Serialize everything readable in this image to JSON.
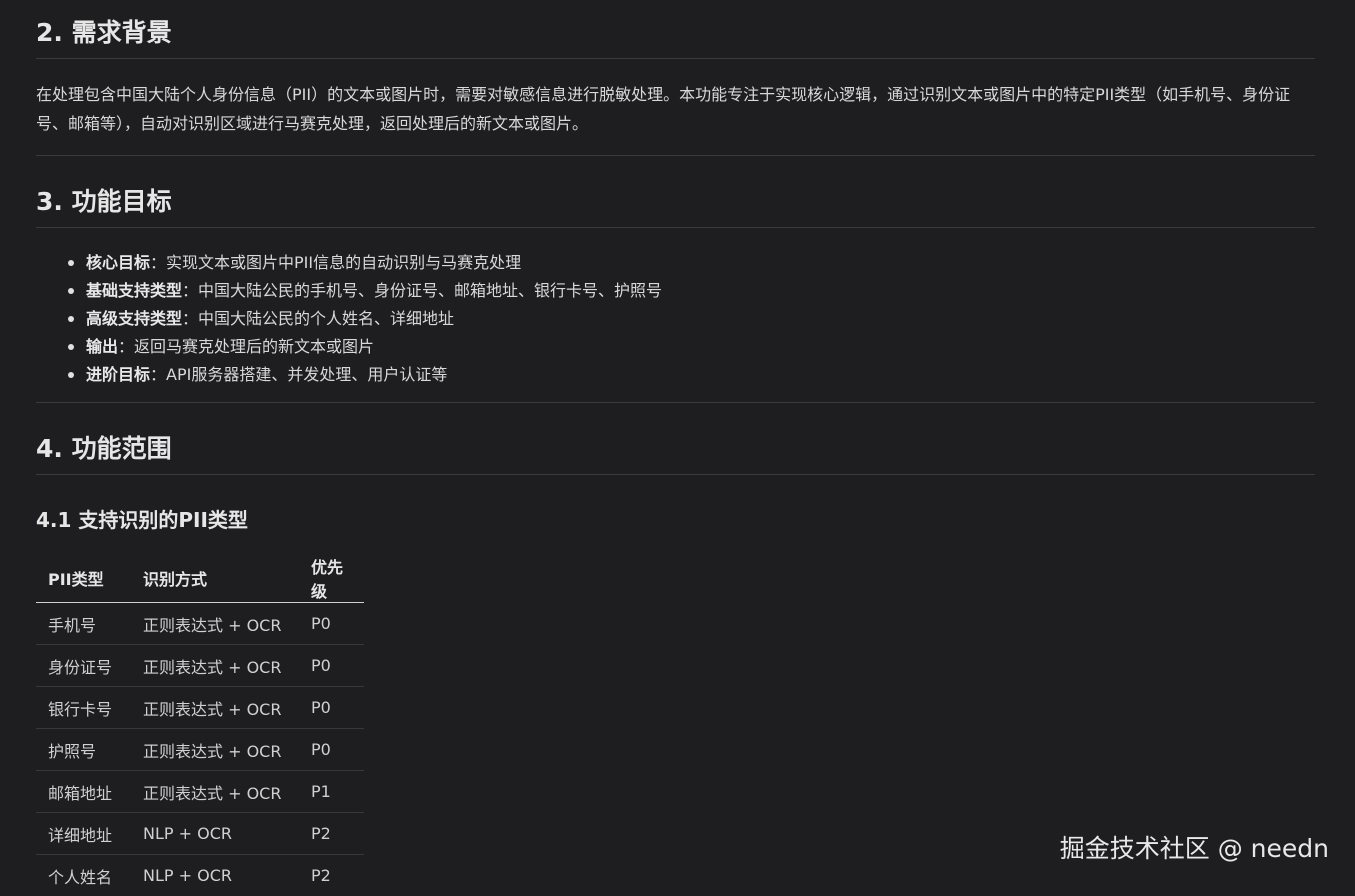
{
  "section2": {
    "title": "2. 需求背景",
    "paragraph": "在处理包含中国大陆个人身份信息（PII）的文本或图片时，需要对敏感信息进行脱敏处理。本功能专注于实现核心逻辑，通过识别文本或图片中的特定PII类型（如手机号、身份证号、邮箱等），自动对识别区域进行马赛克处理，返回处理后的新文本或图片。"
  },
  "section3": {
    "title": "3. 功能目标",
    "goals": [
      {
        "key": "核心目标",
        "sep": "：",
        "text": "实现文本或图片中PII信息的自动识别与马赛克处理"
      },
      {
        "key": "基础支持类型",
        "sep": "：",
        "text": "中国大陆公民的手机号、身份证号、邮箱地址、银行卡号、护照号"
      },
      {
        "key": "高级支持类型",
        "sep": "：",
        "text": "中国大陆公民的个人姓名、详细地址"
      },
      {
        "key": "输出",
        "sep": "：",
        "text": "返回马赛克处理后的新文本或图片"
      },
      {
        "key": "进阶目标",
        "sep": "：",
        "text": "API服务器搭建、并发处理、用户认证等"
      }
    ]
  },
  "section4": {
    "title": "4. 功能范围",
    "subsection": {
      "title": "4.1 支持识别的PII类型",
      "table": {
        "headers": [
          "PII类型",
          "识别方式",
          "优先级"
        ],
        "rows": [
          [
            "手机号",
            "正则表达式 + OCR",
            "P0"
          ],
          [
            "身份证号",
            "正则表达式 + OCR",
            "P0"
          ],
          [
            "银行卡号",
            "正则表达式 + OCR",
            "P0"
          ],
          [
            "护照号",
            "正则表达式 + OCR",
            "P0"
          ],
          [
            "邮箱地址",
            "正则表达式 + OCR",
            "P1"
          ],
          [
            "详细地址",
            "NLP + OCR",
            "P2"
          ],
          [
            "个人姓名",
            "NLP + OCR",
            "P2"
          ]
        ]
      }
    }
  },
  "watermark": "掘金技术社区 @ needn"
}
